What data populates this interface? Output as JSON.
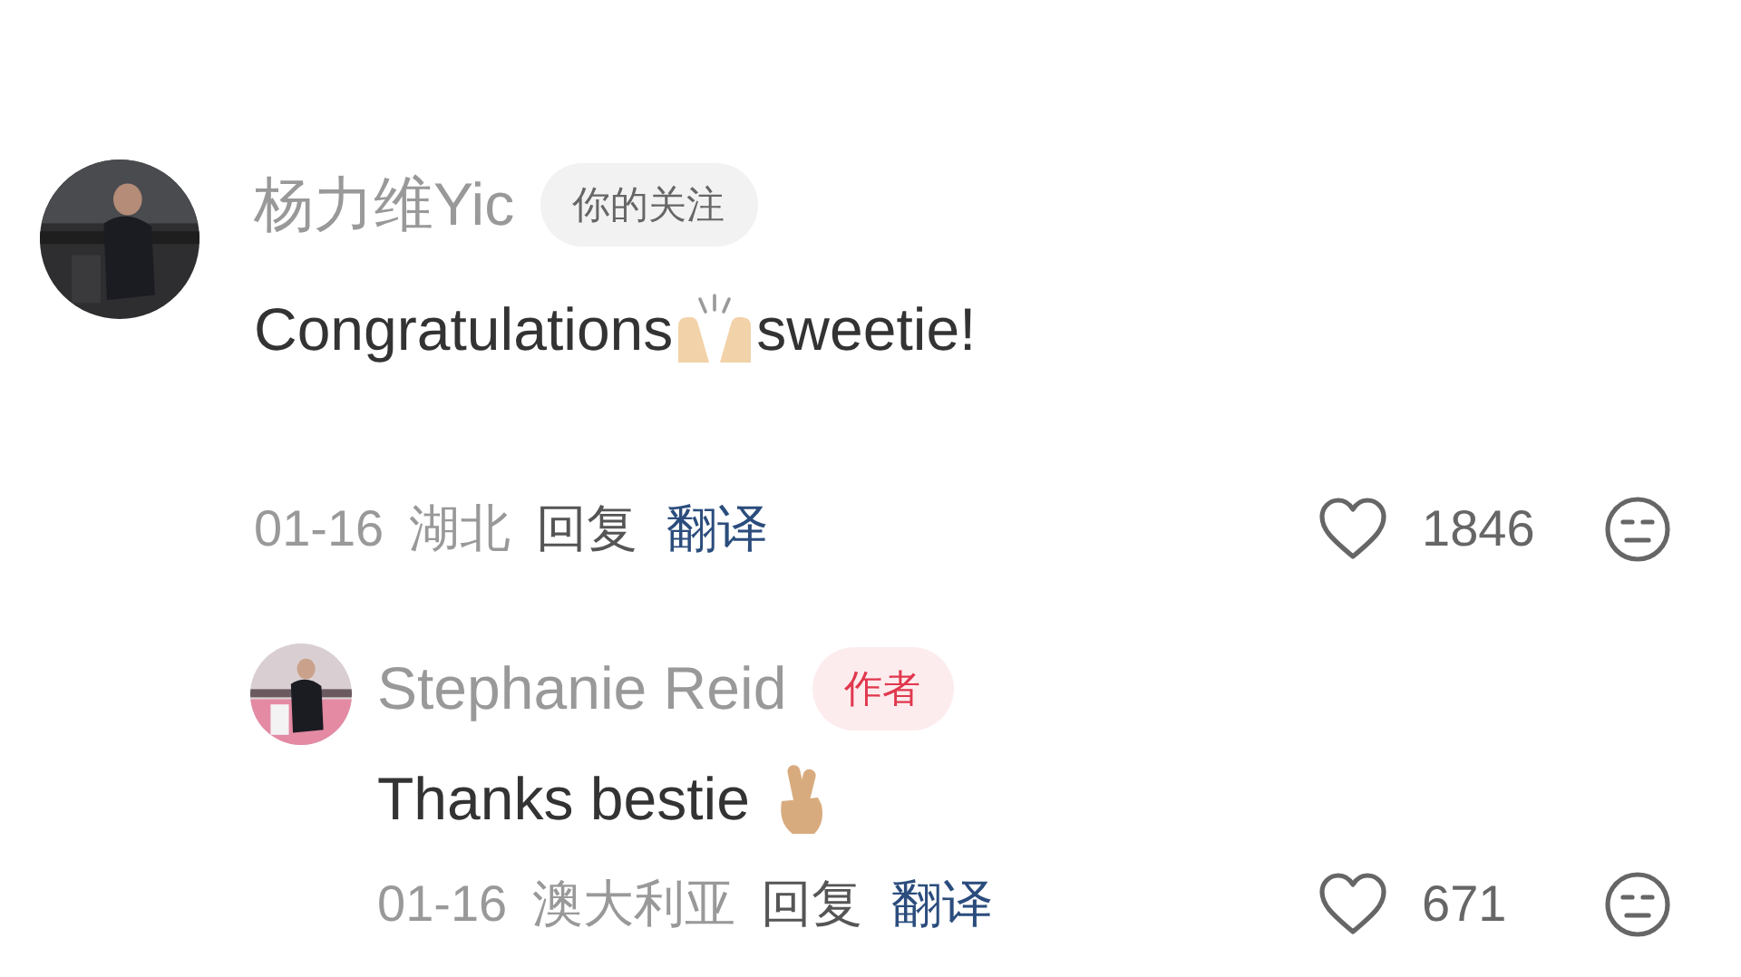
{
  "comments": [
    {
      "author": "杨力维Yic",
      "badge": {
        "kind": "following",
        "text": "你的关注"
      },
      "body": [
        {
          "kind": "text",
          "text": "Congratulations"
        },
        {
          "kind": "raised-hands"
        },
        {
          "kind": "text",
          "text": "sweetie!"
        }
      ],
      "date": "01-16",
      "location": "湖北",
      "reply_label": "回复",
      "translate_label": "翻译",
      "likes": "1846",
      "liked": false,
      "replies": [
        {
          "author": "Stephanie Reid",
          "badge": {
            "kind": "author",
            "text": "作者"
          },
          "body": [
            {
              "kind": "text",
              "text": "Thanks bestie "
            },
            {
              "kind": "crossed-fingers"
            }
          ],
          "date": "01-16",
          "location": "澳大利亚",
          "reply_label": "回复",
          "translate_label": "翻译",
          "likes": "671",
          "liked": false
        }
      ]
    }
  ]
}
